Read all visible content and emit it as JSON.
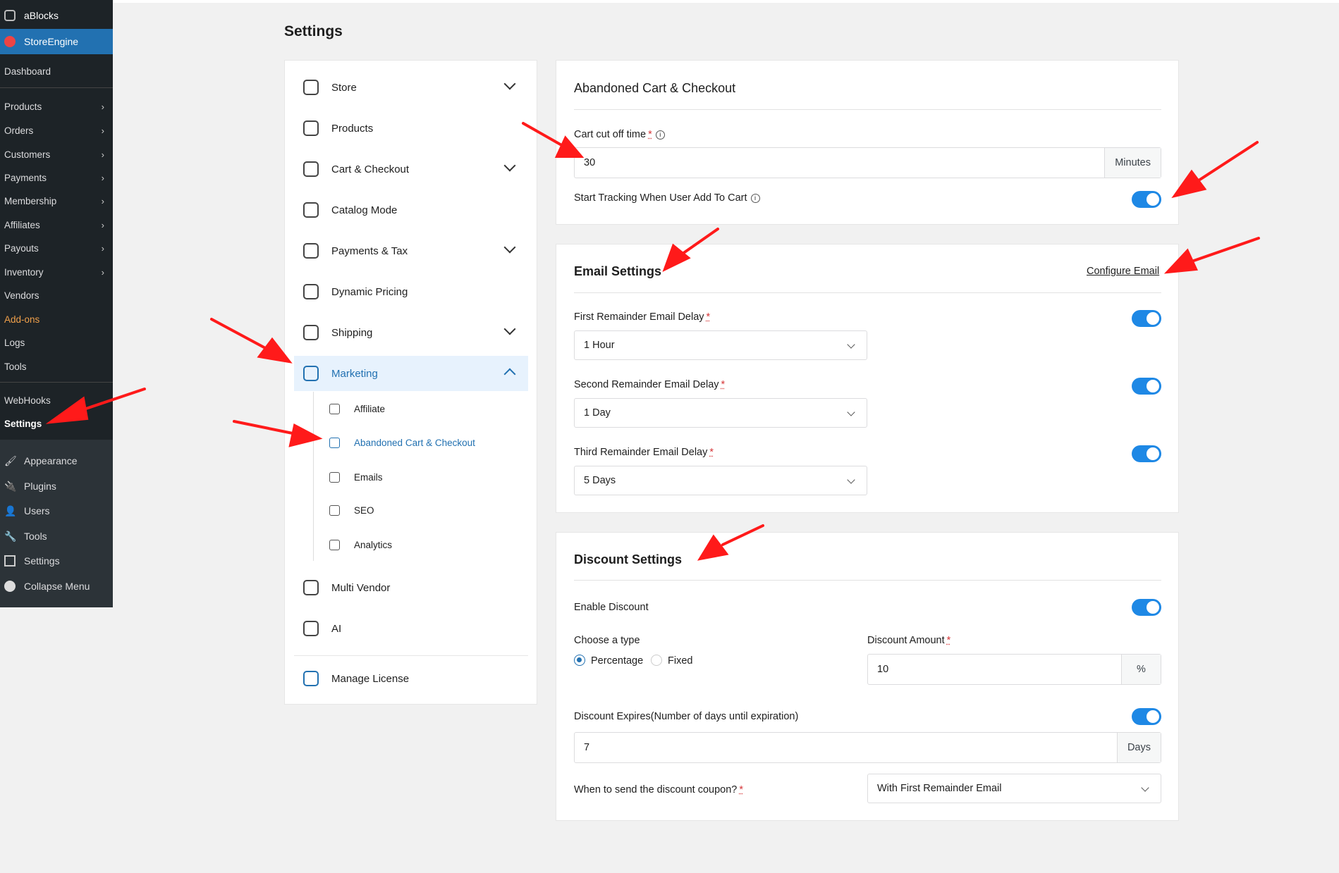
{
  "wp_menu": {
    "ablocks": "aBlocks",
    "storeengine": "StoreEngine",
    "dashboard": "Dashboard",
    "products": "Products",
    "orders": "Orders",
    "customers": "Customers",
    "payments": "Payments",
    "membership": "Membership",
    "affiliates": "Affiliates",
    "payouts": "Payouts",
    "inventory": "Inventory",
    "vendors": "Vendors",
    "addons": "Add-ons",
    "logs": "Logs",
    "tools": "Tools",
    "webhooks": "WebHooks",
    "settings": "Settings",
    "appearance": "Appearance",
    "plugins": "Plugins",
    "users": "Users",
    "wp_tools": "Tools",
    "wp_settings": "Settings",
    "collapse": "Collapse Menu"
  },
  "page": {
    "title": "Settings"
  },
  "settings_nav": {
    "store": "Store",
    "products": "Products",
    "cart_checkout": "Cart & Checkout",
    "catalog_mode": "Catalog Mode",
    "payments_tax": "Payments & Tax",
    "dynamic_pricing": "Dynamic Pricing",
    "shipping": "Shipping",
    "marketing": "Marketing",
    "sub": {
      "affiliate": "Affiliate",
      "abandoned": "Abandoned Cart & Checkout",
      "emails": "Emails",
      "seo": "SEO",
      "analytics": "Analytics"
    },
    "multi_vendor": "Multi Vendor",
    "ai": "AI",
    "manage_license": "Manage License"
  },
  "abandoned": {
    "title": "Abandoned Cart & Checkout",
    "cutoff_label": "Cart cut off time",
    "cutoff_value": "30",
    "cutoff_unit": "Minutes",
    "tracking_label": "Start Tracking When User Add To Cart"
  },
  "email": {
    "title": "Email Settings",
    "configure": "Configure Email",
    "first_label": "First Remainder Email Delay",
    "first_value": "1 Hour",
    "second_label": "Second Remainder Email Delay",
    "second_value": "1 Day",
    "third_label": "Third Remainder Email Delay",
    "third_value": "5 Days"
  },
  "discount": {
    "title": "Discount Settings",
    "enable_label": "Enable Discount",
    "type_label": "Choose a type",
    "percentage": "Percentage",
    "fixed": "Fixed",
    "amount_label": "Discount Amount",
    "amount_value": "10",
    "amount_unit": "%",
    "expires_label": "Discount Expires(Number of days until expiration)",
    "expires_value": "7",
    "expires_unit": "Days",
    "send_label": "When to send the discount coupon?",
    "send_value": "With First Remainder Email"
  },
  "colors": {
    "accent": "#1e88e5",
    "arrow": "#ff1a1a",
    "sidebar": "#1d2327",
    "addons": "#f0a04b"
  }
}
